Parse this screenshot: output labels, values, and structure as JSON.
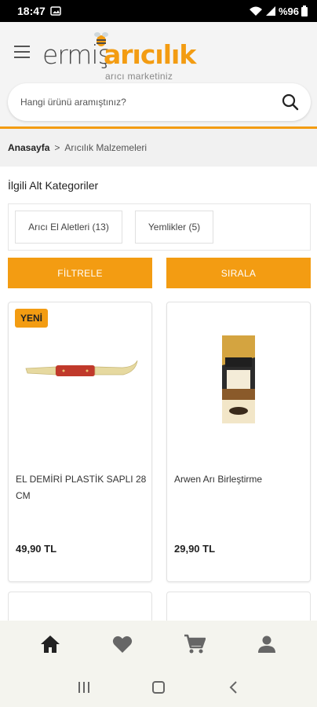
{
  "status_bar": {
    "time": "18:47",
    "battery": "%96"
  },
  "header": {
    "logo_part1": "ermiş",
    "logo_part2": "arıcılık",
    "logo_tagline": "arıcı marketiniz"
  },
  "search": {
    "placeholder": "Hangi ürünü aramıştınız?"
  },
  "breadcrumb": {
    "home": "Anasayfa",
    "separator": ">",
    "current": "Arıcılık Malzemeleri"
  },
  "subcategories": {
    "title": "İlgili Alt Kategoriler",
    "items": [
      {
        "label": "Arıcı El Aletleri (13)"
      },
      {
        "label": "Yemlikler (5)"
      }
    ]
  },
  "actions": {
    "filter_label": "FİLTRELE",
    "sort_label": "SIRALA"
  },
  "products": [
    {
      "badge": "YENİ",
      "name": "EL DEMİRİ PLASTİK SAPLI 28 CM",
      "price": "49,90 TL"
    },
    {
      "badge": "",
      "name": "Arwen Arı Birleştirme",
      "price": "29,90 TL"
    }
  ],
  "bottom_nav": {
    "items": [
      {
        "icon": "home-icon"
      },
      {
        "icon": "heart-icon"
      },
      {
        "icon": "cart-icon"
      },
      {
        "icon": "account-icon"
      }
    ]
  },
  "colors": {
    "accent": "#f39c12",
    "text": "#222222"
  }
}
